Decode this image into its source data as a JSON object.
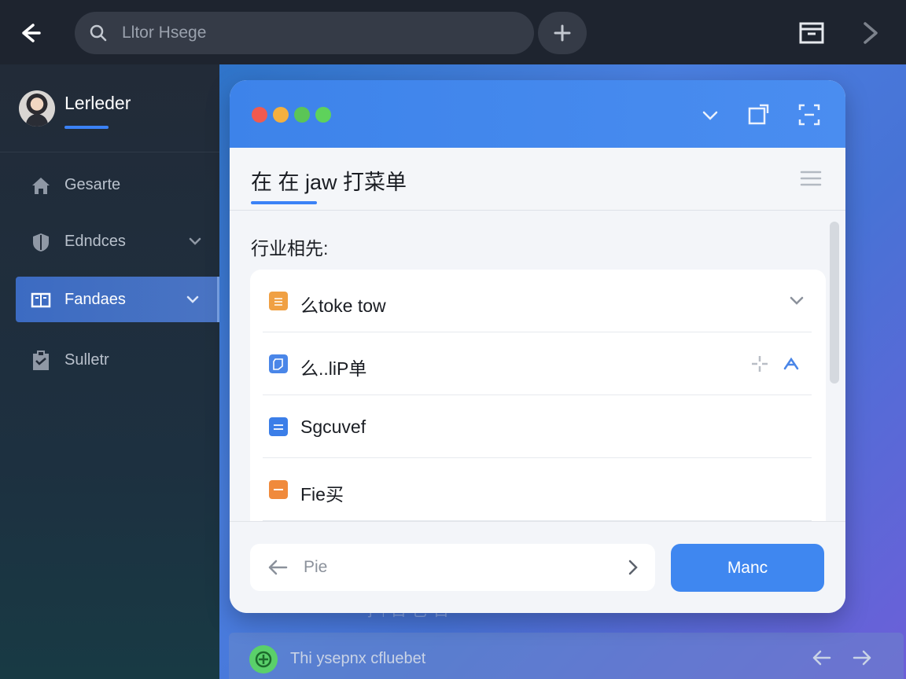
{
  "topbar": {
    "search_placeholder": "Lltor Hsege"
  },
  "sidebar": {
    "profile_name": "Lerleder",
    "items": [
      {
        "label": "Gesarte",
        "icon": "home-icon"
      },
      {
        "label": "Edndces",
        "icon": "shield-icon"
      },
      {
        "label": "Fandaes",
        "icon": "book-icon",
        "active": true
      },
      {
        "label": "Sulletr",
        "icon": "clipboard-icon"
      }
    ]
  },
  "dialog": {
    "title": "在 在 jaw 打菜单",
    "section_label": "行业相先:",
    "items": [
      {
        "label": "么toke tow",
        "icon_color": "#f0a043"
      },
      {
        "label": "么..liP单",
        "icon_color": "#4a86e8"
      },
      {
        "label": "Sgcuvef",
        "icon_color": "#3b7ee8"
      },
      {
        "label": "Fie买",
        "icon_color": "#f08a3c"
      }
    ],
    "pager_text": "Pie",
    "primary_button": "Manc"
  },
  "background": {
    "faint_text": "扌ᵢ 口 巳 口"
  },
  "bottombar": {
    "text": "Thi ysepnx cfluebet"
  },
  "colors": {
    "accent": "#3b82f6",
    "dot_red": "#f05a4f",
    "dot_orange": "#f4b03e",
    "dot_green": "#5bc556",
    "dot_green2": "#5ed25b"
  }
}
